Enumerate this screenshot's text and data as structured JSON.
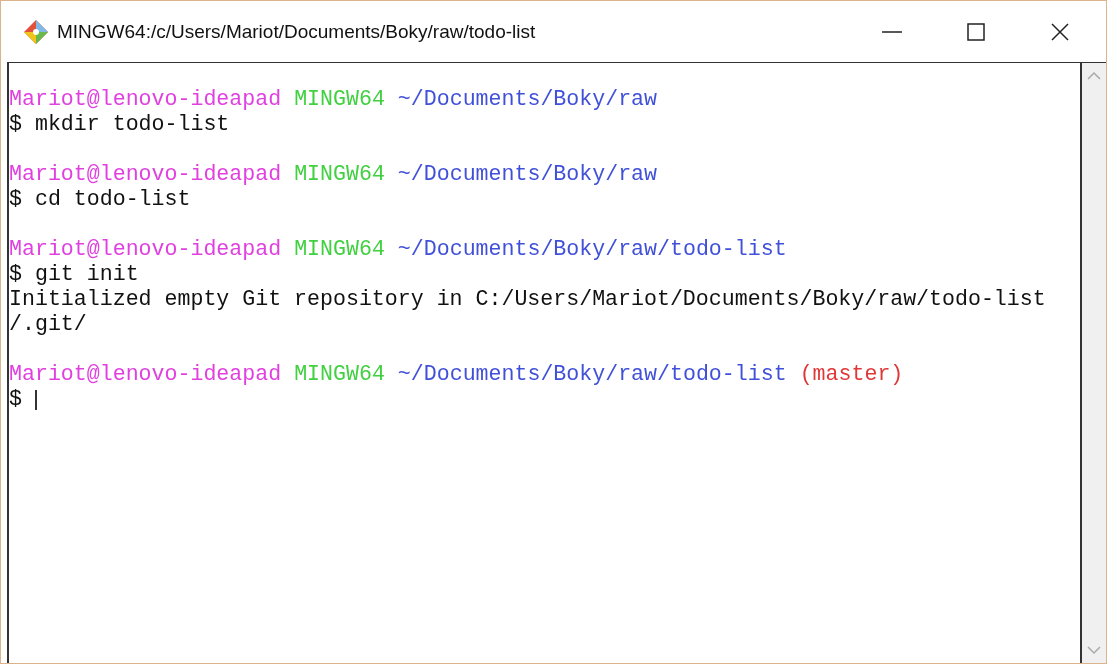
{
  "window": {
    "title": "MINGW64:/c/Users/Mariot/Documents/Boky/raw/todo-list"
  },
  "terminal": {
    "blocks": [
      {
        "prompt": {
          "user": "Mariot@lenovo-ideapad",
          "host": "MINGW64",
          "path": "~/Documents/Boky/raw"
        },
        "command": "$ mkdir todo-list"
      },
      {
        "prompt": {
          "user": "Mariot@lenovo-ideapad",
          "host": "MINGW64",
          "path": "~/Documents/Boky/raw"
        },
        "command": "$ cd todo-list"
      },
      {
        "prompt": {
          "user": "Mariot@lenovo-ideapad",
          "host": "MINGW64",
          "path": "~/Documents/Boky/raw/todo-list"
        },
        "command": "$ git init",
        "output": [
          "Initialized empty Git repository in C:/Users/Mariot/Documents/Boky/raw/todo-list",
          "/.git/"
        ]
      },
      {
        "prompt": {
          "user": "Mariot@lenovo-ideapad",
          "host": "MINGW64",
          "path": "~/Documents/Boky/raw/todo-list",
          "branch": "(master)"
        },
        "command": "$",
        "cursor": true
      }
    ]
  }
}
